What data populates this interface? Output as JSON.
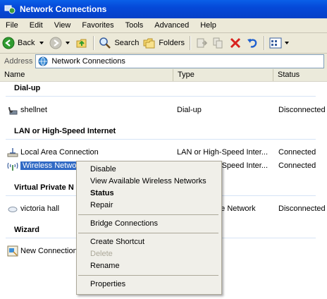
{
  "window": {
    "title": "Network Connections"
  },
  "menu": [
    "File",
    "Edit",
    "View",
    "Favorites",
    "Tools",
    "Advanced",
    "Help"
  ],
  "toolbar": {
    "back_label": "Back",
    "search_label": "Search",
    "folders_label": "Folders"
  },
  "address": {
    "label": "Address",
    "value": "Network Connections"
  },
  "columns": {
    "name": "Name",
    "type": "Type",
    "status": "Status"
  },
  "groups": {
    "dialup": "Dial-up",
    "lan": "LAN or High-Speed Internet",
    "vpn": "Virtual Private N",
    "wizard": "Wizard"
  },
  "rows": {
    "shellnet": {
      "name": "shellnet",
      "type": "Dial-up",
      "status": "Disconnected"
    },
    "lan": {
      "name": "Local Area Connection",
      "type": "LAN or High-Speed Inter...",
      "status": "Connected"
    },
    "wireless": {
      "name": "Wireless Network",
      "type": "LAN or High-Speed Inter...",
      "status": "Connected"
    },
    "victoria": {
      "name": "victoria hall",
      "type": "Virtual Private Network",
      "status": "Disconnected"
    },
    "wizard": {
      "name": "New Connection"
    }
  },
  "context_menu": {
    "disable": "Disable",
    "view_wireless": "View Available Wireless Networks",
    "status": "Status",
    "repair": "Repair",
    "bridge": "Bridge Connections",
    "shortcut": "Create Shortcut",
    "delete": "Delete",
    "rename": "Rename",
    "properties": "Properties"
  },
  "colors": {
    "title_bar": "#0a5fe8",
    "selection": "#316ac5",
    "menu_disabled": "#aca899"
  },
  "icons": {
    "title": "network-connections-icon",
    "back": "back-arrow-icon",
    "forward": "forward-arrow-icon",
    "up": "up-folder-icon",
    "search": "search-icon",
    "folders": "folders-icon",
    "views": "views-icon"
  }
}
